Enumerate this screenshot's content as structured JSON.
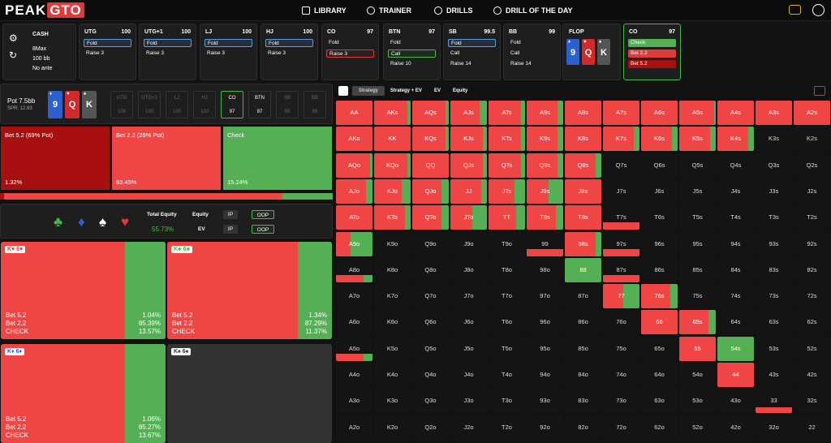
{
  "nav": {
    "logo_a": "PEAK",
    "logo_b": "GTO",
    "library": "LIBRARY",
    "trainer": "TRAINER",
    "drills": "DRILLS",
    "drill_day": "DRILL OF THE DAY"
  },
  "game": {
    "type": "CASH",
    "max": "8Max",
    "stack": "100 bb",
    "ante": "No ante"
  },
  "positions": [
    {
      "name": "UTG",
      "stack": "100",
      "opts": [
        {
          "t": "Fold",
          "c": "sel"
        },
        {
          "t": "Raise 3",
          "c": ""
        }
      ]
    },
    {
      "name": "UTG+1",
      "stack": "100",
      "opts": [
        {
          "t": "Fold",
          "c": "sel"
        },
        {
          "t": "Raise 3",
          "c": ""
        }
      ]
    },
    {
      "name": "LJ",
      "stack": "100",
      "opts": [
        {
          "t": "Fold",
          "c": "sel"
        },
        {
          "t": "Raise 3",
          "c": ""
        }
      ]
    },
    {
      "name": "HJ",
      "stack": "100",
      "opts": [
        {
          "t": "Fold",
          "c": "sel"
        },
        {
          "t": "Raise 3",
          "c": ""
        }
      ]
    },
    {
      "name": "CO",
      "stack": "97",
      "opts": [
        {
          "t": "Fold",
          "c": ""
        },
        {
          "t": "Raise 3",
          "c": "selr"
        }
      ]
    },
    {
      "name": "BTN",
      "stack": "97",
      "opts": [
        {
          "t": "Fold",
          "c": ""
        },
        {
          "t": "Call",
          "c": "selc"
        },
        {
          "t": "Raise 10",
          "c": ""
        }
      ]
    },
    {
      "name": "SB",
      "stack": "99.5",
      "opts": [
        {
          "t": "Fold",
          "c": "sel"
        },
        {
          "t": "Call",
          "c": ""
        },
        {
          "t": "Raise 14",
          "c": ""
        }
      ]
    },
    {
      "name": "BB",
      "stack": "99",
      "opts": [
        {
          "t": "Fold",
          "c": ""
        },
        {
          "t": "Call",
          "c": ""
        },
        {
          "t": "Raise 14",
          "c": ""
        }
      ]
    }
  ],
  "flop": {
    "label": "FLOP",
    "cards": [
      {
        "r": "9",
        "s": "♦",
        "bg": "#2c5fd0"
      },
      {
        "r": "Q",
        "s": "♥",
        "bg": "#d02a2a"
      },
      {
        "r": "K",
        "s": "♠",
        "bg": "#555555"
      }
    ]
  },
  "active": {
    "name": "CO",
    "stack": "97",
    "opts": [
      {
        "t": "Check",
        "c": "g"
      },
      {
        "t": "Bet 2.2",
        "c": "r"
      },
      {
        "t": "Bet 5.2",
        "c": "dr"
      }
    ]
  },
  "pot": {
    "label": "Pot",
    "value": "7.5bb",
    "spr": "SPR: 12.93"
  },
  "posbar": [
    {
      "n": "UTG",
      "v": "100"
    },
    {
      "n": "UTG+1",
      "v": "100"
    },
    {
      "n": "LJ",
      "v": "100"
    },
    {
      "n": "HJ",
      "v": "100"
    },
    {
      "n": "CO",
      "v": "97"
    },
    {
      "n": "BTN",
      "v": "97"
    },
    {
      "n": "SB",
      "v": "99"
    },
    {
      "n": "BB",
      "v": "99"
    }
  ],
  "strategy": [
    {
      "label": "Bet 5.2 (69% Pot)",
      "pct": "1.32%",
      "color": "#a80f0f"
    },
    {
      "label": "Bet 2.2 (29% Pot)",
      "pct": "83.45%",
      "color": "#f04545"
    },
    {
      "label": "Check",
      "pct": "15.24%",
      "color": "#55b055"
    }
  ],
  "equity": {
    "total_label": "Total Equity",
    "total": "55.73%",
    "equity_label": "Equity",
    "ev_label": "EV",
    "ip": "IP",
    "oop": "OOP"
  },
  "combos": [
    {
      "hand": "K♥ 6♥",
      "b52": "1.04%",
      "b22": "85.39%",
      "chk": "13.57%",
      "bet52": 0.0104,
      "bet22": 0.8539,
      "check": 0.1357
    },
    {
      "hand": "K♣ 6♣",
      "b52": "1.34%",
      "b22": "87.29%",
      "chk": "11.37%",
      "bet52": 0.0134,
      "bet22": 0.8729,
      "check": 0.1137
    },
    {
      "hand": "K♦ 6♦",
      "b52": "1.06%",
      "b22": "85.27%",
      "chk": "13.67%",
      "bet52": 0.0106,
      "bet22": 0.8527,
      "check": 0.1367
    },
    {
      "hand": "K♠ 6♠",
      "b52": "",
      "b22": "",
      "chk": "",
      "bet52": 0,
      "bet22": 0,
      "check": 0
    }
  ],
  "combo_labels": {
    "b52": "Bet 5.2",
    "b22": "Bet 2.2",
    "chk": "CHECK"
  },
  "tabs": {
    "strategy": "Strategy",
    "strategy_ev": "Strategy + EV",
    "ev": "EV",
    "equity": "Equity"
  },
  "ranks": [
    "A",
    "K",
    "Q",
    "J",
    "T",
    "9",
    "8",
    "7",
    "6",
    "5",
    "4",
    "3",
    "2"
  ],
  "grid_fills": {
    "AA": [
      0,
      1,
      0
    ],
    "AKs": [
      0,
      0.92,
      0.08
    ],
    "AQs": [
      0,
      0.9,
      0.1
    ],
    "AJs": [
      0,
      0.8,
      0.2
    ],
    "ATs": [
      0,
      0.88,
      0.12
    ],
    "A9s": [
      0,
      0.85,
      0.15
    ],
    "A8s": [
      0,
      1,
      0
    ],
    "A7s": [
      0,
      1,
      0
    ],
    "A6s": [
      0,
      1,
      0
    ],
    "A5s": [
      0,
      0.95,
      0.05
    ],
    "A4s": [
      0,
      1,
      0
    ],
    "A3s": [
      0,
      1,
      0
    ],
    "A2s": [
      0,
      1,
      0
    ],
    "AKo": [
      0,
      1,
      0
    ],
    "KK": [
      0,
      1,
      0
    ],
    "KQs": [
      0,
      0.92,
      0.08
    ],
    "KJs": [
      0,
      0.88,
      0.12
    ],
    "KTs": [
      0,
      0.88,
      0.12
    ],
    "K9s": [
      0,
      0.85,
      0.15
    ],
    "K8s": [
      0,
      1,
      0
    ],
    "K7s": [
      0,
      0.85,
      0.15
    ],
    "K6s": [
      0,
      0.85,
      0.15
    ],
    "K5s": [
      0,
      0.85,
      0.15
    ],
    "K4s": [
      0,
      0.85,
      0.15
    ],
    "AQo": [
      0,
      0.93,
      0.07
    ],
    "KQo": [
      0,
      0.9,
      0.1
    ],
    "QQ": [
      0,
      1,
      0
    ],
    "QJs": [
      0,
      0.88,
      0.12
    ],
    "QTs": [
      0,
      0.88,
      0.12
    ],
    "Q9s": [
      0,
      0.85,
      0.15
    ],
    "Q8s": [
      0,
      0.85,
      0.15
    ],
    "AJo": [
      0,
      0.83,
      0.17
    ],
    "KJo": [
      0,
      0.75,
      0.25
    ],
    "QJo": [
      0,
      0.8,
      0.2
    ],
    "JJ": [
      0,
      0.85,
      0.15
    ],
    "JTs": [
      0,
      0.7,
      0.3
    ],
    "J9s": [
      0,
      0.6,
      0.4
    ],
    "J8s": [
      0,
      1,
      0
    ],
    "ATo": [
      0,
      1,
      0
    ],
    "KTo": [
      0,
      0.85,
      0.15
    ],
    "QTo": [
      0,
      0.8,
      0.2
    ],
    "JTo": [
      0,
      0.6,
      0.4
    ],
    "TT": [
      0,
      0.75,
      0.25
    ],
    "T9s": [
      0,
      0.8,
      0.2
    ],
    "T8s": [
      0,
      1,
      0
    ],
    "A9o": [
      0,
      0.4,
      0.6
    ],
    "99": [
      0,
      0,
      0
    ],
    "98s": [
      0,
      0.85,
      0.15
    ],
    "97s": [
      0,
      0,
      0
    ],
    "88": [
      0,
      0,
      1
    ],
    "87s": [
      0,
      0,
      0
    ],
    "77": [
      0,
      0.55,
      0.45
    ],
    "76s": [
      0,
      0.8,
      0.2
    ],
    "66": [
      0,
      1,
      0
    ],
    "65s": [
      0,
      0.8,
      0.2
    ],
    "55": [
      0,
      1,
      0
    ],
    "54s": [
      0,
      0,
      1
    ],
    "44": [
      0,
      1,
      0
    ]
  },
  "bottom_fills": {
    "A8o": 0.3,
    "T7s": 0.3,
    "A5o": 0.3,
    "97s": 0.3,
    "87s": 0.3,
    "99": 0.3,
    "33": 0.25
  }
}
